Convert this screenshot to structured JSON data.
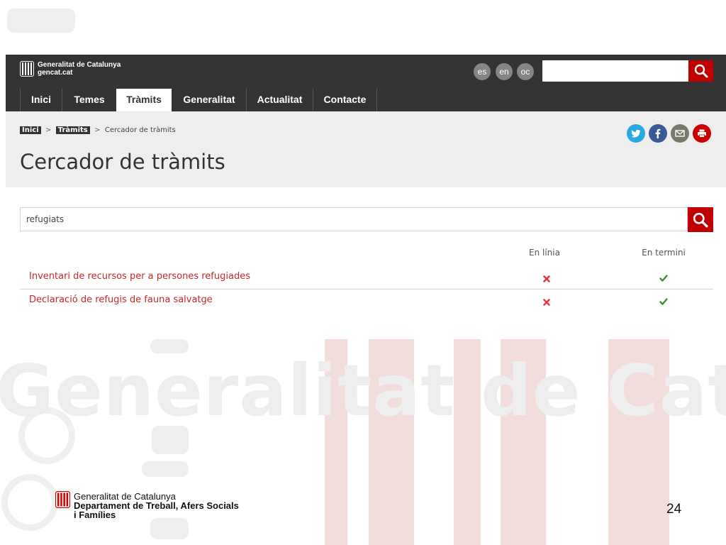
{
  "colors": {
    "brand_red": "#c00000",
    "header_dark": "#333333",
    "link_red": "#c62828",
    "success_green": "#3a8f2e",
    "error_red": "#e53935"
  },
  "background": {
    "watermark": "Generalitat de Catalu"
  },
  "header": {
    "logo_line1": "Generalitat de Catalunya",
    "logo_line2": "gencat.cat",
    "languages": [
      "es",
      "en",
      "oc"
    ],
    "search_placeholder": ""
  },
  "nav": {
    "items": [
      {
        "label": "Inici"
      },
      {
        "label": "Temes"
      },
      {
        "label": "Tràmits",
        "active": true
      },
      {
        "label": "Generalitat"
      },
      {
        "label": "Actualitat"
      },
      {
        "label": "Contacte"
      }
    ]
  },
  "breadcrumb": {
    "items": [
      "Inici",
      "Tràmits"
    ],
    "separator": ">",
    "current": "Cercador de tràmits"
  },
  "social": [
    "twitter-icon",
    "facebook-icon",
    "email-icon",
    "print-icon"
  ],
  "page_title": "Cercador de tràmits",
  "search": {
    "value": "refugiats"
  },
  "results": {
    "columns": [
      "En línia",
      "En termini"
    ],
    "rows": [
      {
        "title": "Inventari de recursos per a persones refugiades",
        "en_linia": false,
        "en_termini": true
      },
      {
        "title": "Declaració de refugis de fauna salvatge",
        "en_linia": false,
        "en_termini": true
      }
    ]
  },
  "footer": {
    "org": "Generalitat de Catalunya",
    "dept_line1": "Departament de Treball, Afers Socials",
    "dept_line2": "i Famílies",
    "page_number": "24"
  }
}
